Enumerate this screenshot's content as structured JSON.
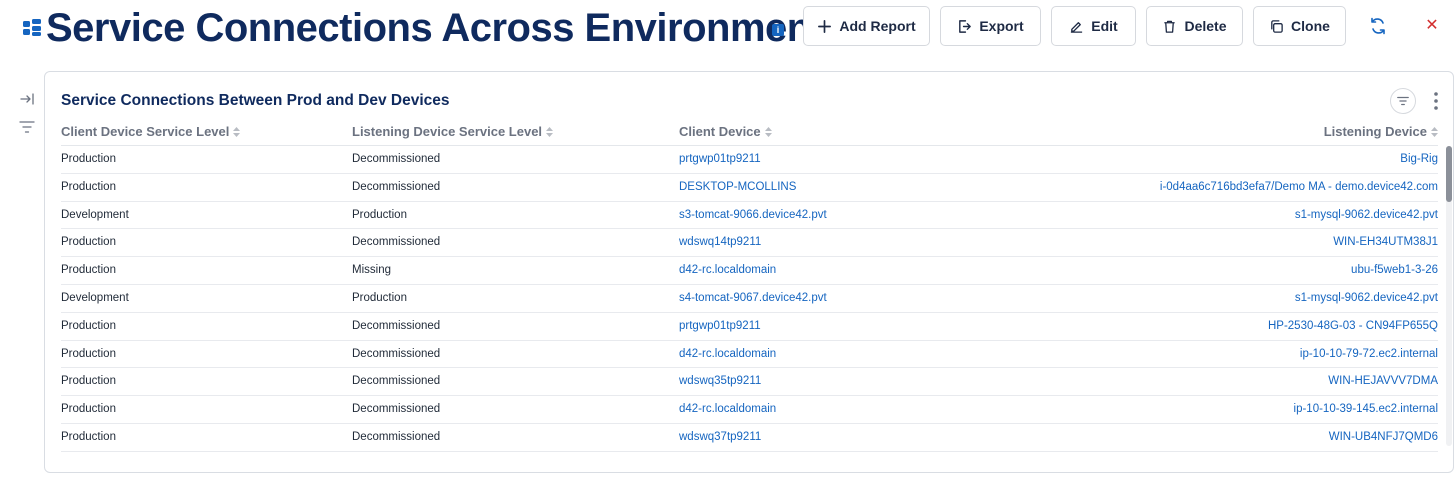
{
  "header": {
    "title": "Service Connections Across Environments",
    "info_glyph": "i",
    "buttons": {
      "add_report": "Add Report",
      "export": "Export",
      "edit": "Edit",
      "delete": "Delete",
      "clone": "Clone"
    },
    "close_glyph": "✕"
  },
  "card": {
    "title": "Service Connections Between Prod and Dev Devices",
    "columns": [
      "Client Device Service Level",
      "Listening Device Service Level",
      "Client Device",
      "Listening Device"
    ],
    "rows": [
      [
        "Production",
        "Decommissioned",
        "prtgwp01tp9211",
        "Big-Rig"
      ],
      [
        "Production",
        "Decommissioned",
        "DESKTOP-MCOLLINS",
        "i-0d4aa6c716bd3efa7/Demo MA - demo.device42.com"
      ],
      [
        "Development",
        "Production",
        "s3-tomcat-9066.device42.pvt",
        "s1-mysql-9062.device42.pvt"
      ],
      [
        "Production",
        "Decommissioned",
        "wdswq14tp9211",
        "WIN-EH34UTM38J1"
      ],
      [
        "Production",
        "Missing",
        "d42-rc.localdomain",
        "ubu-f5web1-3-26"
      ],
      [
        "Development",
        "Production",
        "s4-tomcat-9067.device42.pvt",
        "s1-mysql-9062.device42.pvt"
      ],
      [
        "Production",
        "Decommissioned",
        "prtgwp01tp9211",
        "HP-2530-48G-03 - CN94FP655Q"
      ],
      [
        "Production",
        "Decommissioned",
        "d42-rc.localdomain",
        "ip-10-10-79-72.ec2.internal"
      ],
      [
        "Production",
        "Decommissioned",
        "wdswq35tp9211",
        "WIN-HEJAVVV7DMA"
      ],
      [
        "Production",
        "Decommissioned",
        "d42-rc.localdomain",
        "ip-10-10-39-145.ec2.internal"
      ],
      [
        "Production",
        "Decommissioned",
        "wdswq37tp9211",
        "WIN-UB4NFJ7QMD6"
      ]
    ]
  },
  "colors": {
    "title": "#0f2a5e",
    "link": "#1565c0",
    "danger": "#d32f2f"
  },
  "icons": {
    "app": "dashboard-grid-icon",
    "info": "info-icon",
    "add": "plus-icon",
    "export": "export-icon",
    "edit": "edit-icon",
    "delete": "trash-icon",
    "clone": "clone-icon",
    "refresh": "refresh-icon",
    "close": "close-icon",
    "collapse": "collapse-arrow-icon",
    "filter": "filter-icon",
    "menu": "kebab-menu-icon",
    "sort": "sort-icon"
  }
}
